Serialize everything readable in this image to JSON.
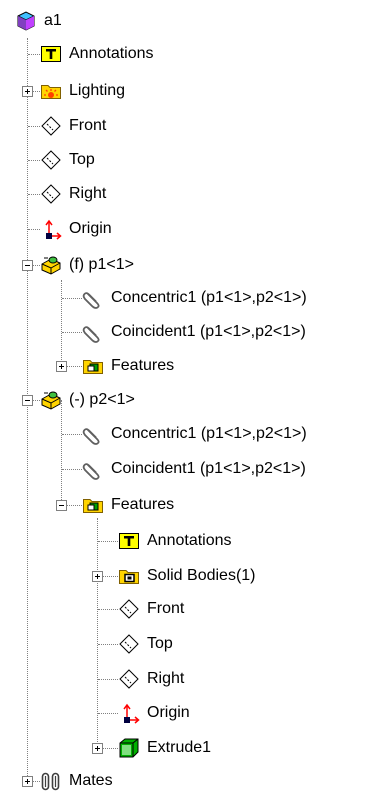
{
  "tree": {
    "root": {
      "label": "a1",
      "icon": "assembly-icon"
    },
    "items": [
      {
        "id": "annotations",
        "label": "Annotations",
        "icon": "annotations-icon"
      },
      {
        "id": "lighting",
        "label": "Lighting",
        "icon": "lighting-folder-icon",
        "expander": "+"
      },
      {
        "id": "front",
        "label": "Front",
        "icon": "plane-icon"
      },
      {
        "id": "top",
        "label": "Top",
        "icon": "plane-icon"
      },
      {
        "id": "right",
        "label": "Right",
        "icon": "plane-icon"
      },
      {
        "id": "origin",
        "label": "Origin",
        "icon": "origin-icon"
      },
      {
        "id": "p1",
        "label": "(f) p1<1>",
        "icon": "part-icon",
        "expander": "-"
      },
      {
        "id": "p1-concentric",
        "label": "Concentric1 (p1<1>,p2<1>)",
        "icon": "mate-clip-icon"
      },
      {
        "id": "p1-coincident",
        "label": "Coincident1 (p1<1>,p2<1>)",
        "icon": "mate-clip-icon"
      },
      {
        "id": "p1-features",
        "label": "Features",
        "icon": "features-folder-icon",
        "expander": "+"
      },
      {
        "id": "p2",
        "label": "(-) p2<1>",
        "icon": "part-icon",
        "expander": "-"
      },
      {
        "id": "p2-concentric",
        "label": "Concentric1 (p1<1>,p2<1>)",
        "icon": "mate-clip-icon"
      },
      {
        "id": "p2-coincident",
        "label": "Coincident1 (p1<1>,p2<1>)",
        "icon": "mate-clip-icon"
      },
      {
        "id": "p2-features",
        "label": "Features",
        "icon": "features-folder-icon",
        "expander": "-"
      },
      {
        "id": "p2-annotations",
        "label": "Annotations",
        "icon": "annotations-icon"
      },
      {
        "id": "p2-solid-bodies",
        "label": "Solid Bodies(1)",
        "icon": "solid-bodies-folder-icon",
        "expander": "+"
      },
      {
        "id": "p2-front",
        "label": "Front",
        "icon": "plane-icon"
      },
      {
        "id": "p2-top",
        "label": "Top",
        "icon": "plane-icon"
      },
      {
        "id": "p2-right",
        "label": "Right",
        "icon": "plane-icon"
      },
      {
        "id": "p2-origin",
        "label": "Origin",
        "icon": "origin-icon"
      },
      {
        "id": "p2-extrude",
        "label": "Extrude1",
        "icon": "extrude-icon",
        "expander": "+"
      },
      {
        "id": "mates",
        "label": "Mates",
        "icon": "mates-icon",
        "expander": "+"
      }
    ]
  },
  "colors": {
    "guide": "#808080",
    "folder": "#ffd400",
    "annotation_bg": "#ffff00",
    "origin_red": "#ff0000",
    "extrude_green": "#00b000",
    "assembly_purple": "#8040c0",
    "assembly_cyan": "#40c0ff"
  }
}
